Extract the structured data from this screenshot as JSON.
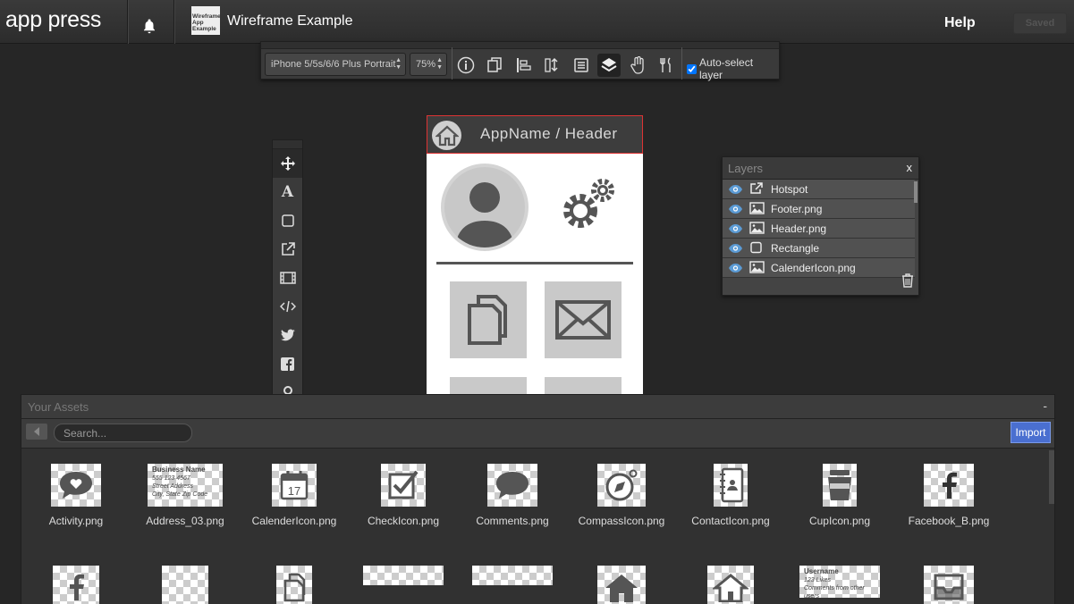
{
  "app": {
    "logo": "app press",
    "project_title": "Wireframe Example",
    "project_thumb_text": "Wireframe App Example"
  },
  "header": {
    "help_label": "Help",
    "saved_label": "Saved"
  },
  "toolbar": {
    "device": "iPhone 5/5s/6/6 Plus Portrait",
    "zoom": "75%",
    "auto_select_label": "Auto-select layer",
    "auto_select_checked": true,
    "icons": [
      "info-icon",
      "pages-icon",
      "align-icon",
      "sort-icon",
      "book-icon",
      "layers-icon",
      "gesture-icon",
      "tools-icon"
    ]
  },
  "side_tools": [
    "move-icon",
    "text-icon",
    "rectangle-icon",
    "hotspot-icon",
    "video-icon",
    "code-icon",
    "twitter-icon",
    "facebook-icon",
    "map-pin-icon"
  ],
  "phone": {
    "header_text": "AppName / Header"
  },
  "layers": {
    "title": "Layers",
    "close": "x",
    "items": [
      {
        "name": "Hotspot",
        "type": "hotspot"
      },
      {
        "name": "Footer.png",
        "type": "image"
      },
      {
        "name": "Header.png",
        "type": "image"
      },
      {
        "name": "Rectangle",
        "type": "rectangle"
      },
      {
        "name": "CalenderIcon.png",
        "type": "image"
      }
    ]
  },
  "assets": {
    "title": "Your Assets",
    "minimize": "-",
    "search_placeholder": "Search...",
    "import_label": "Import",
    "row1": [
      "Activity.png",
      "Address_03.png",
      "CalenderIcon.png",
      "CheckIcon.png",
      "Comments.png",
      "CompassIcon.png",
      "ContactIcon.png",
      "CupIcon.png",
      "Facebook_B.png"
    ],
    "address_card": {
      "name": "Business Name",
      "line1": "555 123 4567",
      "line2": "Street Address",
      "line3": "City, State Zip Code"
    },
    "calendar_day": "17",
    "username_card": {
      "name": "Username",
      "line1": "123 Likes",
      "line2": "Comments from other users"
    }
  }
}
